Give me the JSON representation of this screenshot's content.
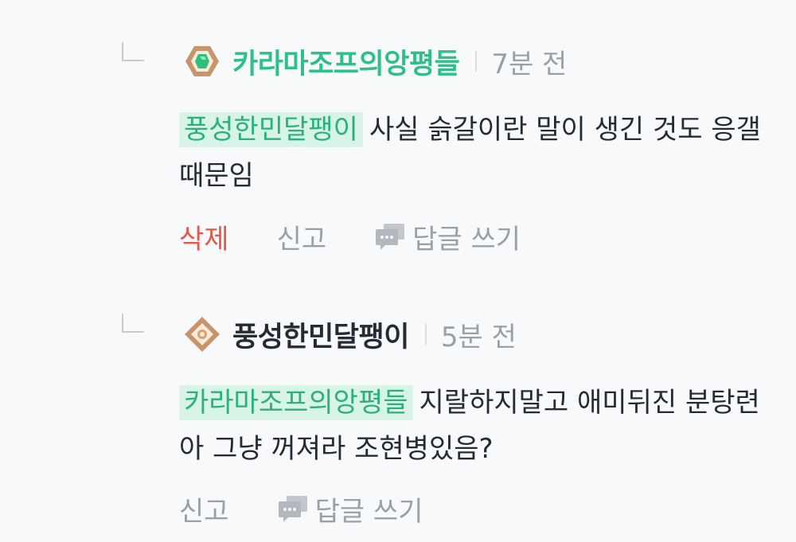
{
  "colors": {
    "mention_bg": "#d7f4e6",
    "mention_text": "#2bb07e",
    "author_highlight": "#2ec08a",
    "delete_red": "#e0594b",
    "muted_gray": "#9aa0a8",
    "badge_brown": "#c8956b"
  },
  "replies": [
    {
      "author": "카라마조프의앙평들",
      "badge_icon": "emerald-hexagon-badge-icon",
      "time": "7분 전",
      "mention": "풍성한민달팽이",
      "text": "사실 슭갈이란 말이 생긴 것도 응갤 때문임",
      "actions": {
        "delete": "삭제",
        "report": "신고",
        "reply": "답글 쓰기"
      }
    },
    {
      "author": "풍성한민달팽이",
      "badge_icon": "bronze-diamond-badge-icon",
      "time": "5분 전",
      "mention": "카라마조프의앙평들",
      "text": "지랄하지말고 애미뒤진 분탕련아 그냥 꺼져라 조현병있음?",
      "actions": {
        "report": "신고",
        "reply": "답글 쓰기"
      }
    }
  ]
}
